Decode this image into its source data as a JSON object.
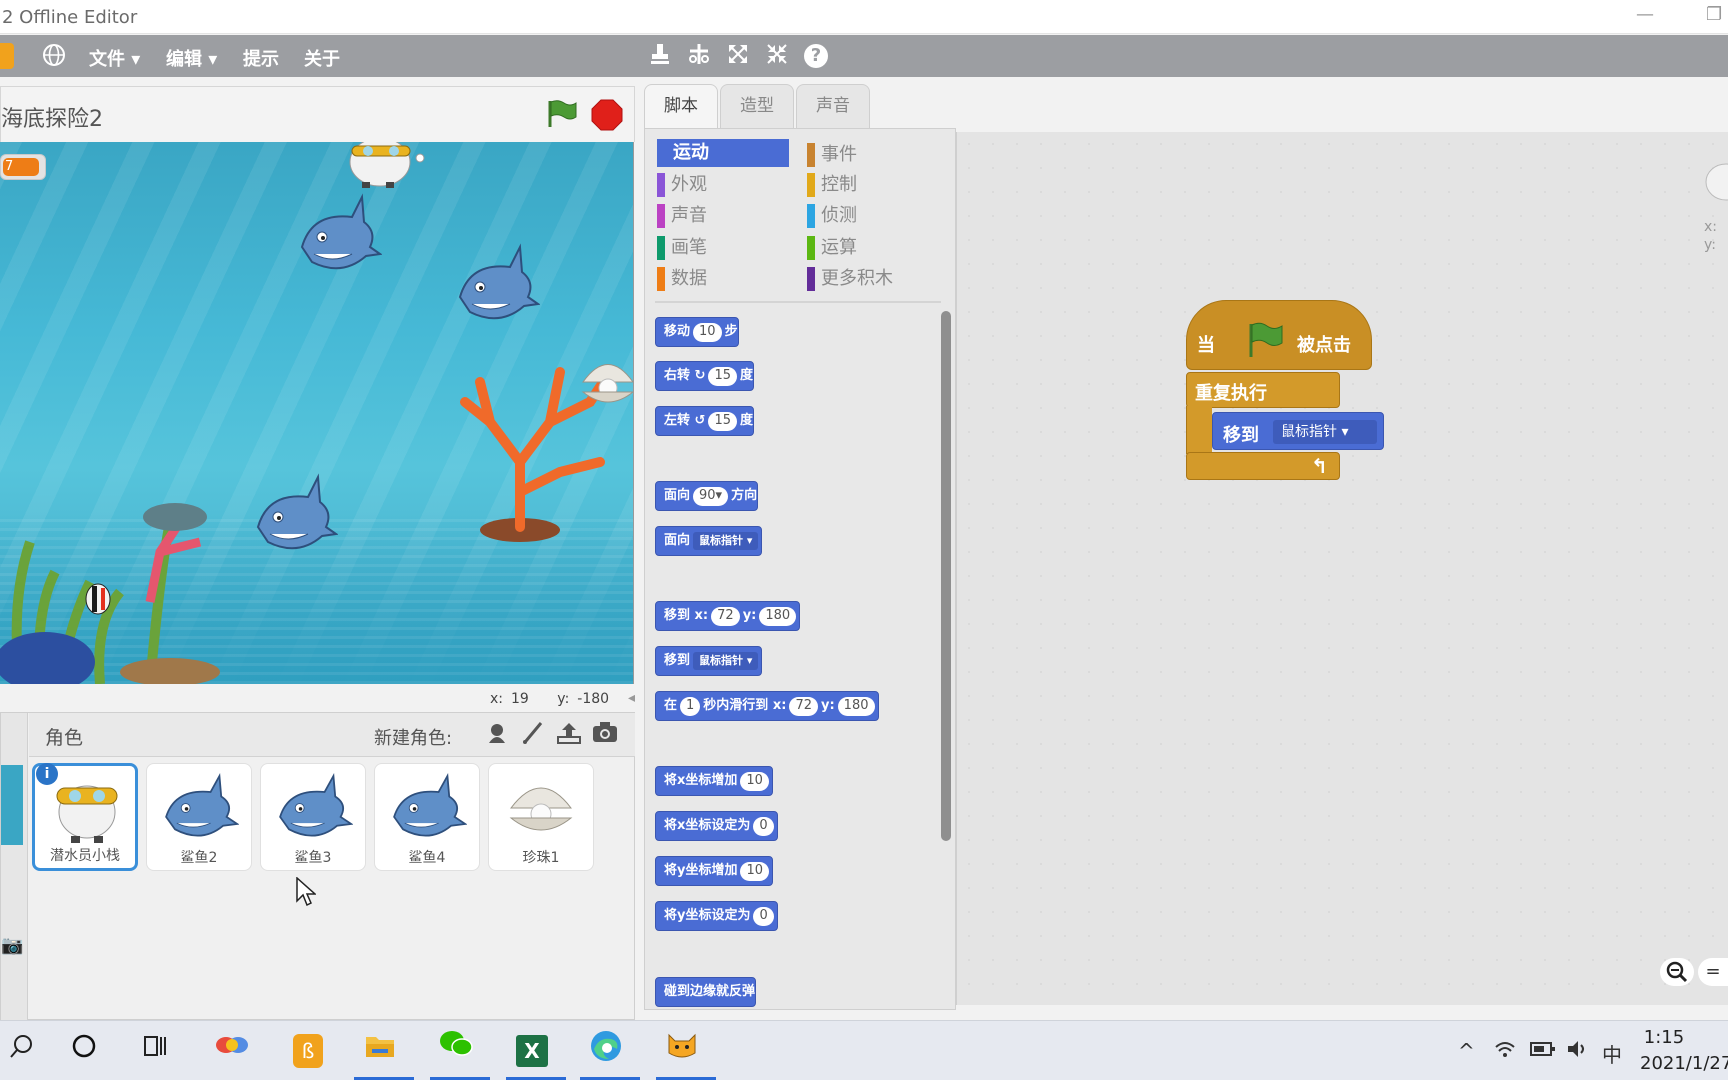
{
  "window": {
    "title": "2 Offline Editor",
    "minimize_glyph": "—",
    "restore_glyph": "❐"
  },
  "menubar": {
    "menus": [
      {
        "label": "文件 ▾"
      },
      {
        "label": "编辑 ▾"
      },
      {
        "label": "提示"
      },
      {
        "label": "关于"
      }
    ],
    "help_glyph": "?"
  },
  "stage": {
    "project_title": "海底探险2",
    "variable_value": "7",
    "x_label": "x:",
    "x_value": "19",
    "y_label": "y:",
    "y_value": "-180"
  },
  "sprites": {
    "header_label": "角色",
    "new_sprite_label": "新建角色:",
    "items": [
      {
        "name": "潜水员小栈",
        "icon": "diver-icon"
      },
      {
        "name": "鲨鱼2",
        "icon": "shark-icon"
      },
      {
        "name": "鲨鱼3",
        "icon": "shark-icon"
      },
      {
        "name": "鲨鱼4",
        "icon": "shark-icon"
      },
      {
        "name": "珍珠1",
        "icon": "pearl-shell-icon"
      }
    ],
    "info_badge": "i"
  },
  "tabs": [
    {
      "label": "脚本",
      "active": true
    },
    {
      "label": "造型",
      "active": false
    },
    {
      "label": "声音",
      "active": false
    }
  ],
  "categories": [
    {
      "label": "运动",
      "color": "#4a6cd4",
      "active": true
    },
    {
      "label": "外观",
      "color": "#8a55d7"
    },
    {
      "label": "声音",
      "color": "#bb42c3"
    },
    {
      "label": "画笔",
      "color": "#0e9a6c"
    },
    {
      "label": "数据",
      "color": "#ee7d16"
    },
    {
      "label": "事件",
      "color": "#c88330"
    },
    {
      "label": "控制",
      "color": "#e1a91a"
    },
    {
      "label": "侦测",
      "color": "#2ca5e2"
    },
    {
      "label": "运算",
      "color": "#5cb712"
    },
    {
      "label": "更多积木",
      "color": "#632d99"
    }
  ],
  "palette_blocks": {
    "move": {
      "a": "移动",
      "n": "10",
      "b": "步"
    },
    "turn_right": {
      "a": "右转",
      "glyph": "↻",
      "n": "15",
      "b": "度"
    },
    "turn_left": {
      "a": "左转",
      "glyph": "↺",
      "n": "15",
      "b": "度"
    },
    "point_dir": {
      "a": "面向",
      "n": "90▾",
      "b": "方向"
    },
    "point_toward": {
      "a": "面向",
      "dd": "鼠标指针 ▾"
    },
    "goto_xy": {
      "a": "移到",
      "xl": "x:",
      "x": "72",
      "yl": "y:",
      "y": "180"
    },
    "goto": {
      "a": "移到",
      "dd": "鼠标指针 ▾"
    },
    "glide": {
      "a": "在",
      "n": "1",
      "b": "秒内滑行到",
      "xl": "x:",
      "x": "72",
      "yl": "y:",
      "y": "180"
    },
    "change_x": {
      "a": "将x坐标增加",
      "n": "10"
    },
    "set_x": {
      "a": "将x坐标设定为",
      "n": "0"
    },
    "change_y": {
      "a": "将y坐标增加",
      "n": "10"
    },
    "set_y": {
      "a": "将y坐标设定为",
      "n": "0"
    },
    "bounce": {
      "a": "碰到边缘就反弹"
    }
  },
  "script": {
    "hat_left": "当",
    "hat_right": "被点击",
    "forever": "重复执行",
    "goto_label": "移到",
    "goto_target": "鼠标指针 ▾",
    "loop_arrow": "↰"
  },
  "script_corner": {
    "x_label": "x:",
    "y_label": "y:"
  },
  "zoom": {
    "out": "−",
    "reset": "="
  },
  "taskbar": {
    "ime": "中",
    "time": "1:15",
    "date": "2021/1/27"
  },
  "colors": {
    "motion": "#4a6cd4",
    "events": "#c98f25",
    "control": "#d39a2a",
    "menubar": "#9c9ea2"
  }
}
